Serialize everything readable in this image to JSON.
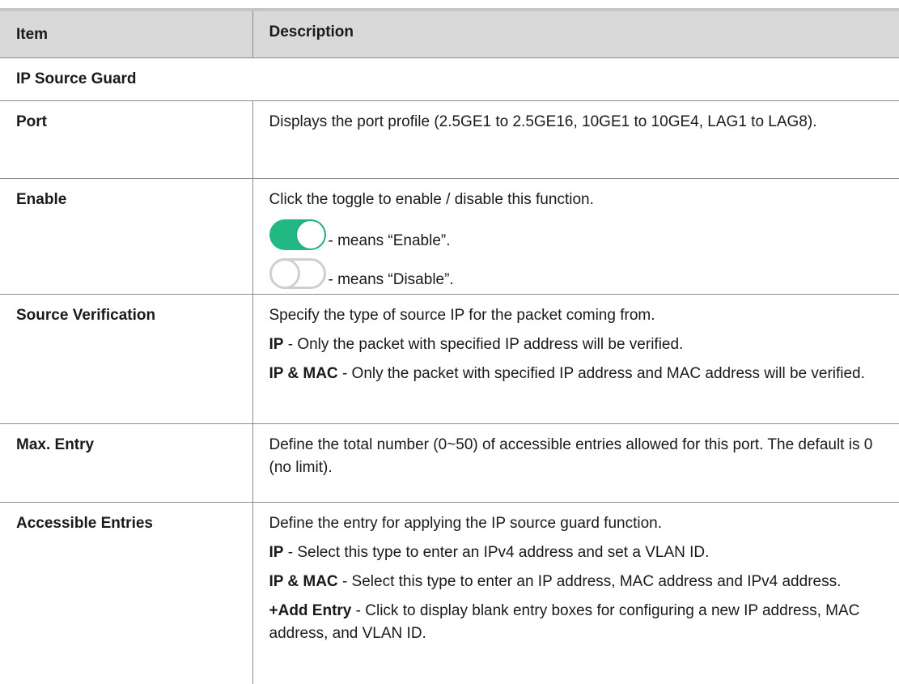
{
  "table": {
    "headers": {
      "item": "Item",
      "description": "Description"
    },
    "section_title": "IP Source Guard",
    "rows": {
      "port": {
        "item": "Port",
        "desc": "Displays the port profile (2.5GE1 to 2.5GE16, 10GE1 to 10GE4, LAG1 to LAG8)."
      },
      "enable": {
        "item": "Enable",
        "desc": "Click the toggle to enable / disable this function.",
        "toggle_on_text": "- means “Enable”.",
        "toggle_off_text": "- means “Disable”.",
        "toggle_on_color": "#22b884",
        "toggle_off_color": "#cfcfcf"
      },
      "source_verification": {
        "item": "Source Verification",
        "desc": "Specify the type of source IP for the packet coming from.",
        "ip_term": "IP",
        "ip_desc": " - Only the packet with specified IP address will be verified.",
        "ipmac_term": "IP & MAC",
        "ipmac_desc": " - Only the packet with specified IP address and MAC address will be verified."
      },
      "max_entry": {
        "item": "Max. Entry",
        "desc": "Define the total number (0~50) of accessible entries allowed for this port. The default is 0 (no limit)."
      },
      "accessible_entries": {
        "item": "Accessible Entries",
        "desc": "Define the entry for applying the IP source guard function.",
        "ip_term": "IP",
        "ip_desc": " - Select this type to enter an IPv4 address and set a VLAN ID.",
        "ipmac_term": "IP & MAC",
        "ipmac_desc": " - Select this type to enter an IP address, MAC address and IPv4 address.",
        "add_term": "+Add Entry",
        "add_desc": " - Click to display blank entry boxes for configuring a new IP address, MAC address, and VLAN ID."
      }
    }
  }
}
